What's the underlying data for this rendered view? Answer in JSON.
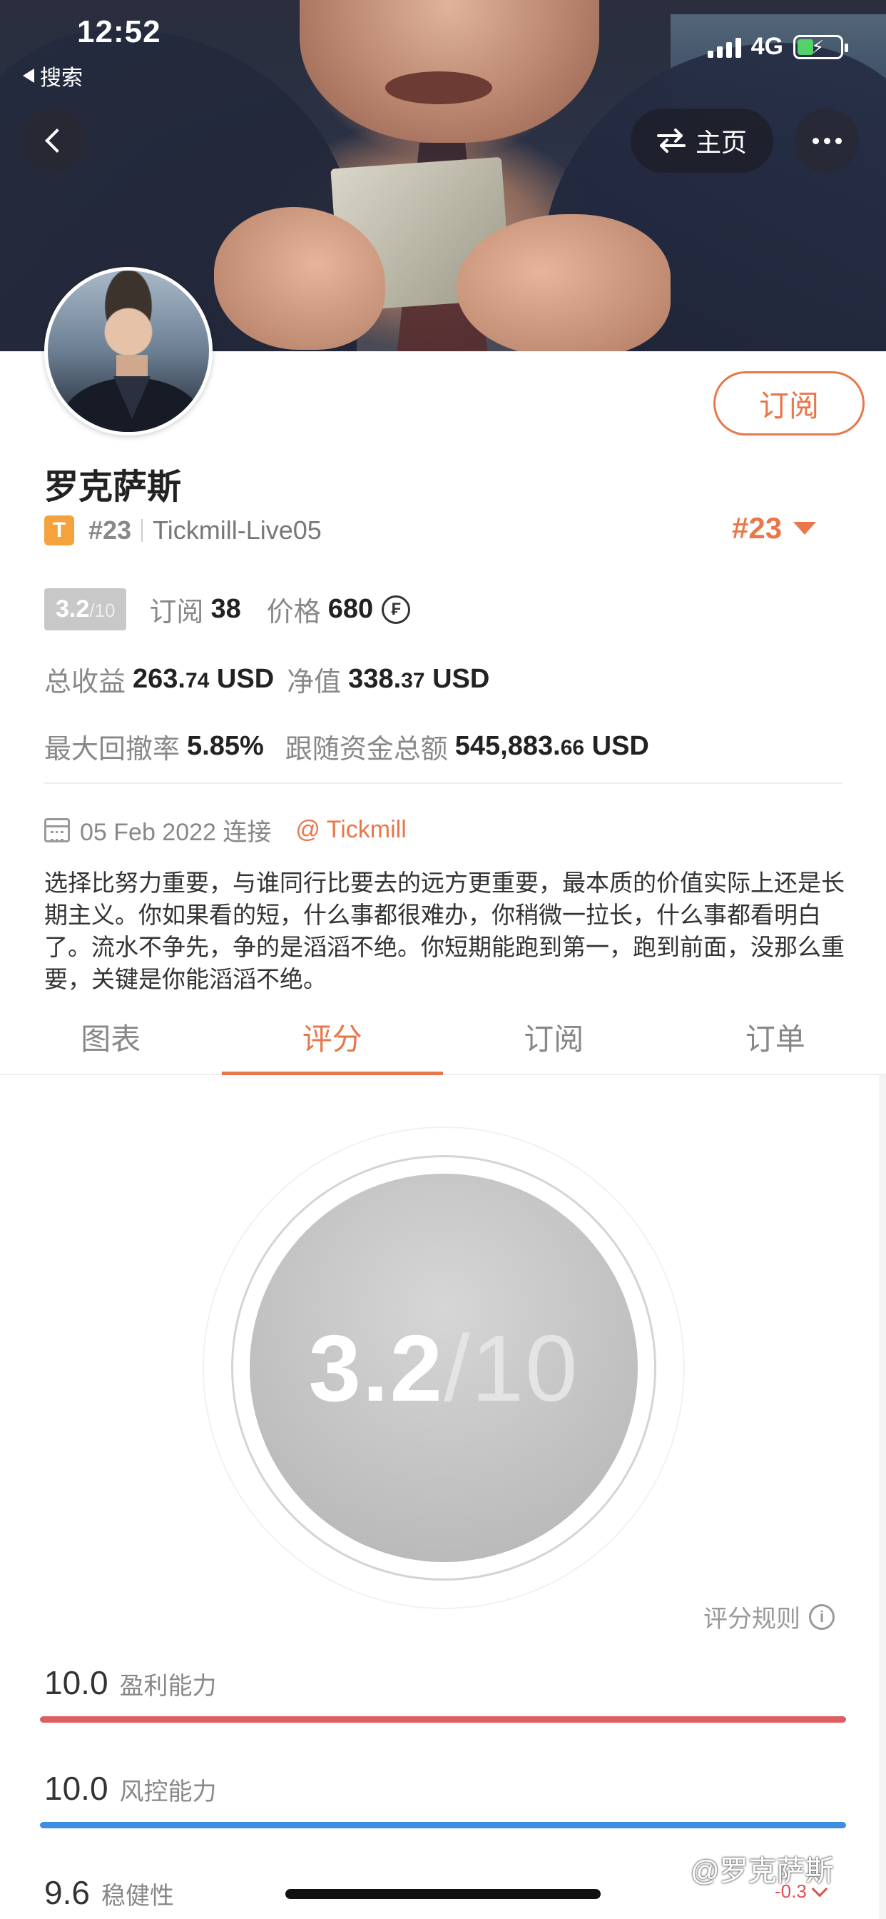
{
  "status_bar": {
    "time": "12:52",
    "back_app": "搜索",
    "network": "4G"
  },
  "nav": {
    "home_label": "主页",
    "icons": [
      "chevron-left-icon",
      "swap-icon",
      "more-icon"
    ]
  },
  "profile": {
    "name": "罗克萨斯",
    "subscribe_label": "订阅",
    "broker_badge": "T",
    "rank": "#23",
    "account": "Tickmill-Live05",
    "rank_right": "#23"
  },
  "stats": {
    "score": "3.2",
    "score_max": "/10",
    "subscribe_label": "订阅",
    "subscribe_count": "38",
    "price_label": "价格",
    "price_value": "680",
    "coin_glyph": "₣",
    "total_profit_label": "总收益",
    "total_profit_int": "263.",
    "total_profit_dec": "74",
    "total_profit_unit": "USD",
    "equity_label": "净值",
    "equity_int": "338.",
    "equity_dec": "37",
    "equity_unit": "USD",
    "max_drawdown_label": "最大回撤率",
    "max_drawdown_value": "5.85%",
    "follow_funds_label": "跟随资金总额",
    "follow_funds_int": "545,883.",
    "follow_funds_dec": "66",
    "follow_funds_unit": "USD"
  },
  "meta": {
    "connected": "05 Feb 2022 连接",
    "broker": "@ Tickmill"
  },
  "bio": "选择比努力重要，与谁同行比要去的远方更重要，最本质的价值实际上还是长期主义。你如果看的短，什么事都很难办，你稍微一拉长，什么事都看明白了。流水不争先，争的是滔滔不绝。你短期能跑到第一，跑到前面，没那么重要，关键是你能滔滔不绝。",
  "tabs": [
    {
      "label": "图表",
      "active": false
    },
    {
      "label": "评分",
      "active": true
    },
    {
      "label": "订阅",
      "active": false
    },
    {
      "label": "订单",
      "active": false
    }
  ],
  "rating": {
    "score": "3.2",
    "max": "/10",
    "rules_label": "评分规则",
    "metrics": [
      {
        "value": "10.0",
        "label": "盈利能力",
        "color": "#dd5f5f"
      },
      {
        "value": "10.0",
        "label": "风控能力",
        "color": "#3d8ee0"
      },
      {
        "value": "9.6",
        "label": "稳健性",
        "delta": "-0.3"
      }
    ]
  },
  "watermark": "@罗克萨斯",
  "colors": {
    "accent": "#e8774a",
    "broker_badge": "#f4a23b",
    "profit_bar": "#dd5f5f",
    "risk_bar": "#3d8ee0"
  }
}
